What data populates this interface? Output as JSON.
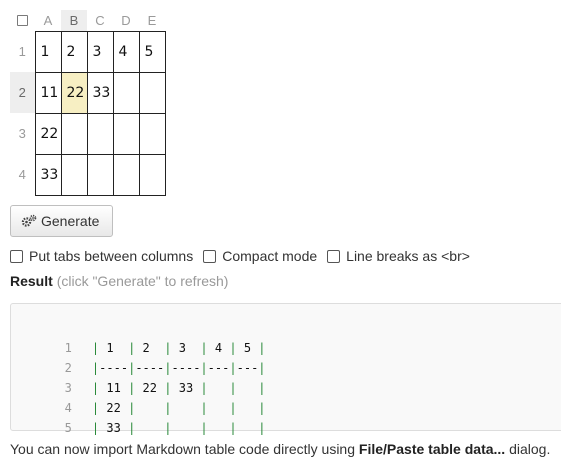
{
  "grid": {
    "columns": [
      "A",
      "B",
      "C",
      "D",
      "E"
    ],
    "rows": [
      "1",
      "2",
      "3",
      "4"
    ],
    "cells": [
      [
        "1",
        "2",
        "3",
        "4",
        "5"
      ],
      [
        "11",
        "22",
        "33",
        "",
        ""
      ],
      [
        "22",
        "",
        "",
        "",
        ""
      ],
      [
        "33",
        "",
        "",
        "",
        ""
      ]
    ],
    "selected": {
      "row": 1,
      "col": 1
    },
    "selected_color": "#f7efc3"
  },
  "generate_button": {
    "label": "Generate",
    "icon": "gears-icon"
  },
  "options": [
    {
      "label": "Put tabs between columns",
      "checked": false
    },
    {
      "label": "Compact mode",
      "checked": false
    },
    {
      "label": "Line breaks as <br>",
      "checked": false
    }
  ],
  "result": {
    "title": "Result",
    "hint": "(click \"Generate\" to refresh)"
  },
  "code_lines": [
    {
      "num": "1",
      "text": "| 1  | 2  | 3  | 4 | 5 |"
    },
    {
      "num": "2",
      "text": "|----|----|----|---|---|"
    },
    {
      "num": "3",
      "text": "| 11 | 22 | 33 |   |   |"
    },
    {
      "num": "4",
      "text": "| 22 |    |    |   |   |"
    },
    {
      "num": "5",
      "text": "| 33 |    |    |   |   |"
    }
  ],
  "footer": {
    "prefix": "You can now import Markdown table code directly using ",
    "link": "File/Paste table data...",
    "suffix": " dialog."
  },
  "colors": {
    "pipe": "#2a8a3a",
    "header_active": "#eeeeee"
  }
}
